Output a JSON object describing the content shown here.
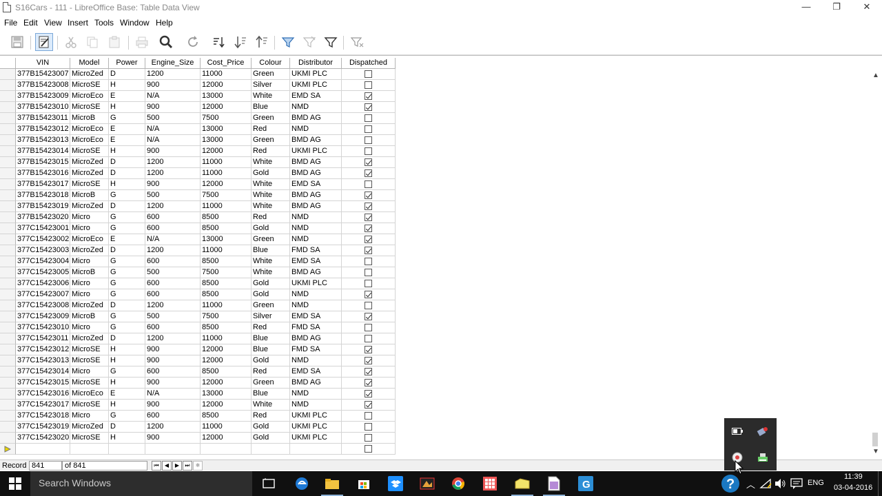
{
  "window": {
    "title": "S16Cars - 111 - LibreOffice Base: Table Data View",
    "min_glyph": "—",
    "max_glyph": "❐",
    "close_glyph": "✕"
  },
  "menu": [
    "File",
    "Edit",
    "View",
    "Insert",
    "Tools",
    "Window",
    "Help"
  ],
  "columns": [
    "VIN",
    "Model",
    "Power",
    "Engine_Size",
    "Cost_Price",
    "Colour",
    "Distributor",
    "Dispatched"
  ],
  "rows": [
    [
      "377B15423007",
      "MicroZed",
      "D",
      "1200",
      "11000",
      "Green",
      "UKMI PLC",
      false
    ],
    [
      "377B15423008",
      "MicroSE",
      "H",
      "900",
      "12000",
      "Silver",
      "UKMI PLC",
      false
    ],
    [
      "377B15423009",
      "MicroEco",
      "E",
      "N/A",
      "13000",
      "White",
      "EMD SA",
      true
    ],
    [
      "377B15423010",
      "MicroSE",
      "H",
      "900",
      "12000",
      "Blue",
      "NMD",
      true
    ],
    [
      "377B15423011",
      "MicroB",
      "G",
      "500",
      "7500",
      "Green",
      "BMD AG",
      false
    ],
    [
      "377B15423012",
      "MicroEco",
      "E",
      "N/A",
      "13000",
      "Red",
      "NMD",
      false
    ],
    [
      "377B15423013",
      "MicroEco",
      "E",
      "N/A",
      "13000",
      "Green",
      "BMD AG",
      false
    ],
    [
      "377B15423014",
      "MicroSE",
      "H",
      "900",
      "12000",
      "Red",
      "UKMI PLC",
      false
    ],
    [
      "377B15423015",
      "MicroZed",
      "D",
      "1200",
      "11000",
      "White",
      "BMD AG",
      true
    ],
    [
      "377B15423016",
      "MicroZed",
      "D",
      "1200",
      "11000",
      "Gold",
      "BMD AG",
      true
    ],
    [
      "377B15423017",
      "MicroSE",
      "H",
      "900",
      "12000",
      "White",
      "EMD SA",
      false
    ],
    [
      "377B15423018",
      "MicroB",
      "G",
      "500",
      "7500",
      "White",
      "BMD AG",
      true
    ],
    [
      "377B15423019",
      "MicroZed",
      "D",
      "1200",
      "11000",
      "White",
      "BMD AG",
      true
    ],
    [
      "377B15423020",
      "Micro",
      "G",
      "600",
      "8500",
      "Red",
      "NMD",
      true
    ],
    [
      "377C15423001",
      "Micro",
      "G",
      "600",
      "8500",
      "Gold",
      "NMD",
      true
    ],
    [
      "377C15423002",
      "MicroEco",
      "E",
      "N/A",
      "13000",
      "Green",
      "NMD",
      true
    ],
    [
      "377C15423003",
      "MicroZed",
      "D",
      "1200",
      "11000",
      "Blue",
      "FMD SA",
      true
    ],
    [
      "377C15423004",
      "Micro",
      "G",
      "600",
      "8500",
      "White",
      "EMD SA",
      false
    ],
    [
      "377C15423005",
      "MicroB",
      "G",
      "500",
      "7500",
      "White",
      "BMD AG",
      false
    ],
    [
      "377C15423006",
      "Micro",
      "G",
      "600",
      "8500",
      "Gold",
      "UKMI PLC",
      false
    ],
    [
      "377C15423007",
      "Micro",
      "G",
      "600",
      "8500",
      "Gold",
      "NMD",
      true
    ],
    [
      "377C15423008",
      "MicroZed",
      "D",
      "1200",
      "11000",
      "Green",
      "NMD",
      false
    ],
    [
      "377C15423009",
      "MicroB",
      "G",
      "500",
      "7500",
      "Silver",
      "EMD SA",
      true
    ],
    [
      "377C15423010",
      "Micro",
      "G",
      "600",
      "8500",
      "Red",
      "FMD SA",
      false
    ],
    [
      "377C15423011",
      "MicroZed",
      "D",
      "1200",
      "11000",
      "Blue",
      "BMD AG",
      false
    ],
    [
      "377C15423012",
      "MicroSE",
      "H",
      "900",
      "12000",
      "Blue",
      "FMD SA",
      true
    ],
    [
      "377C15423013",
      "MicroSE",
      "H",
      "900",
      "12000",
      "Gold",
      "NMD",
      true
    ],
    [
      "377C15423014",
      "Micro",
      "G",
      "600",
      "8500",
      "Red",
      "EMD SA",
      true
    ],
    [
      "377C15423015",
      "MicroSE",
      "H",
      "900",
      "12000",
      "Green",
      "BMD AG",
      true
    ],
    [
      "377C15423016",
      "MicroEco",
      "E",
      "N/A",
      "13000",
      "Blue",
      "NMD",
      true
    ],
    [
      "377C15423017",
      "MicroSE",
      "H",
      "900",
      "12000",
      "White",
      "NMD",
      true
    ],
    [
      "377C15423018",
      "Micro",
      "G",
      "600",
      "8500",
      "Red",
      "UKMI PLC",
      false
    ],
    [
      "377C15423019",
      "MicroZed",
      "D",
      "1200",
      "11000",
      "Gold",
      "UKMI PLC",
      false
    ],
    [
      "377C15423020",
      "MicroSE",
      "H",
      "900",
      "12000",
      "Gold",
      "UKMI PLC",
      false
    ]
  ],
  "record_nav": {
    "label": "Record",
    "current": "841",
    "total": "of 841"
  },
  "taskbar": {
    "search_placeholder": "Search Windows",
    "language": "ENG",
    "time": "11:39",
    "date": "03-04-2016"
  },
  "colors": {
    "accent": "#1e90ff",
    "taskbar_bg": "#101010",
    "search_bg": "#2d2d2d"
  }
}
